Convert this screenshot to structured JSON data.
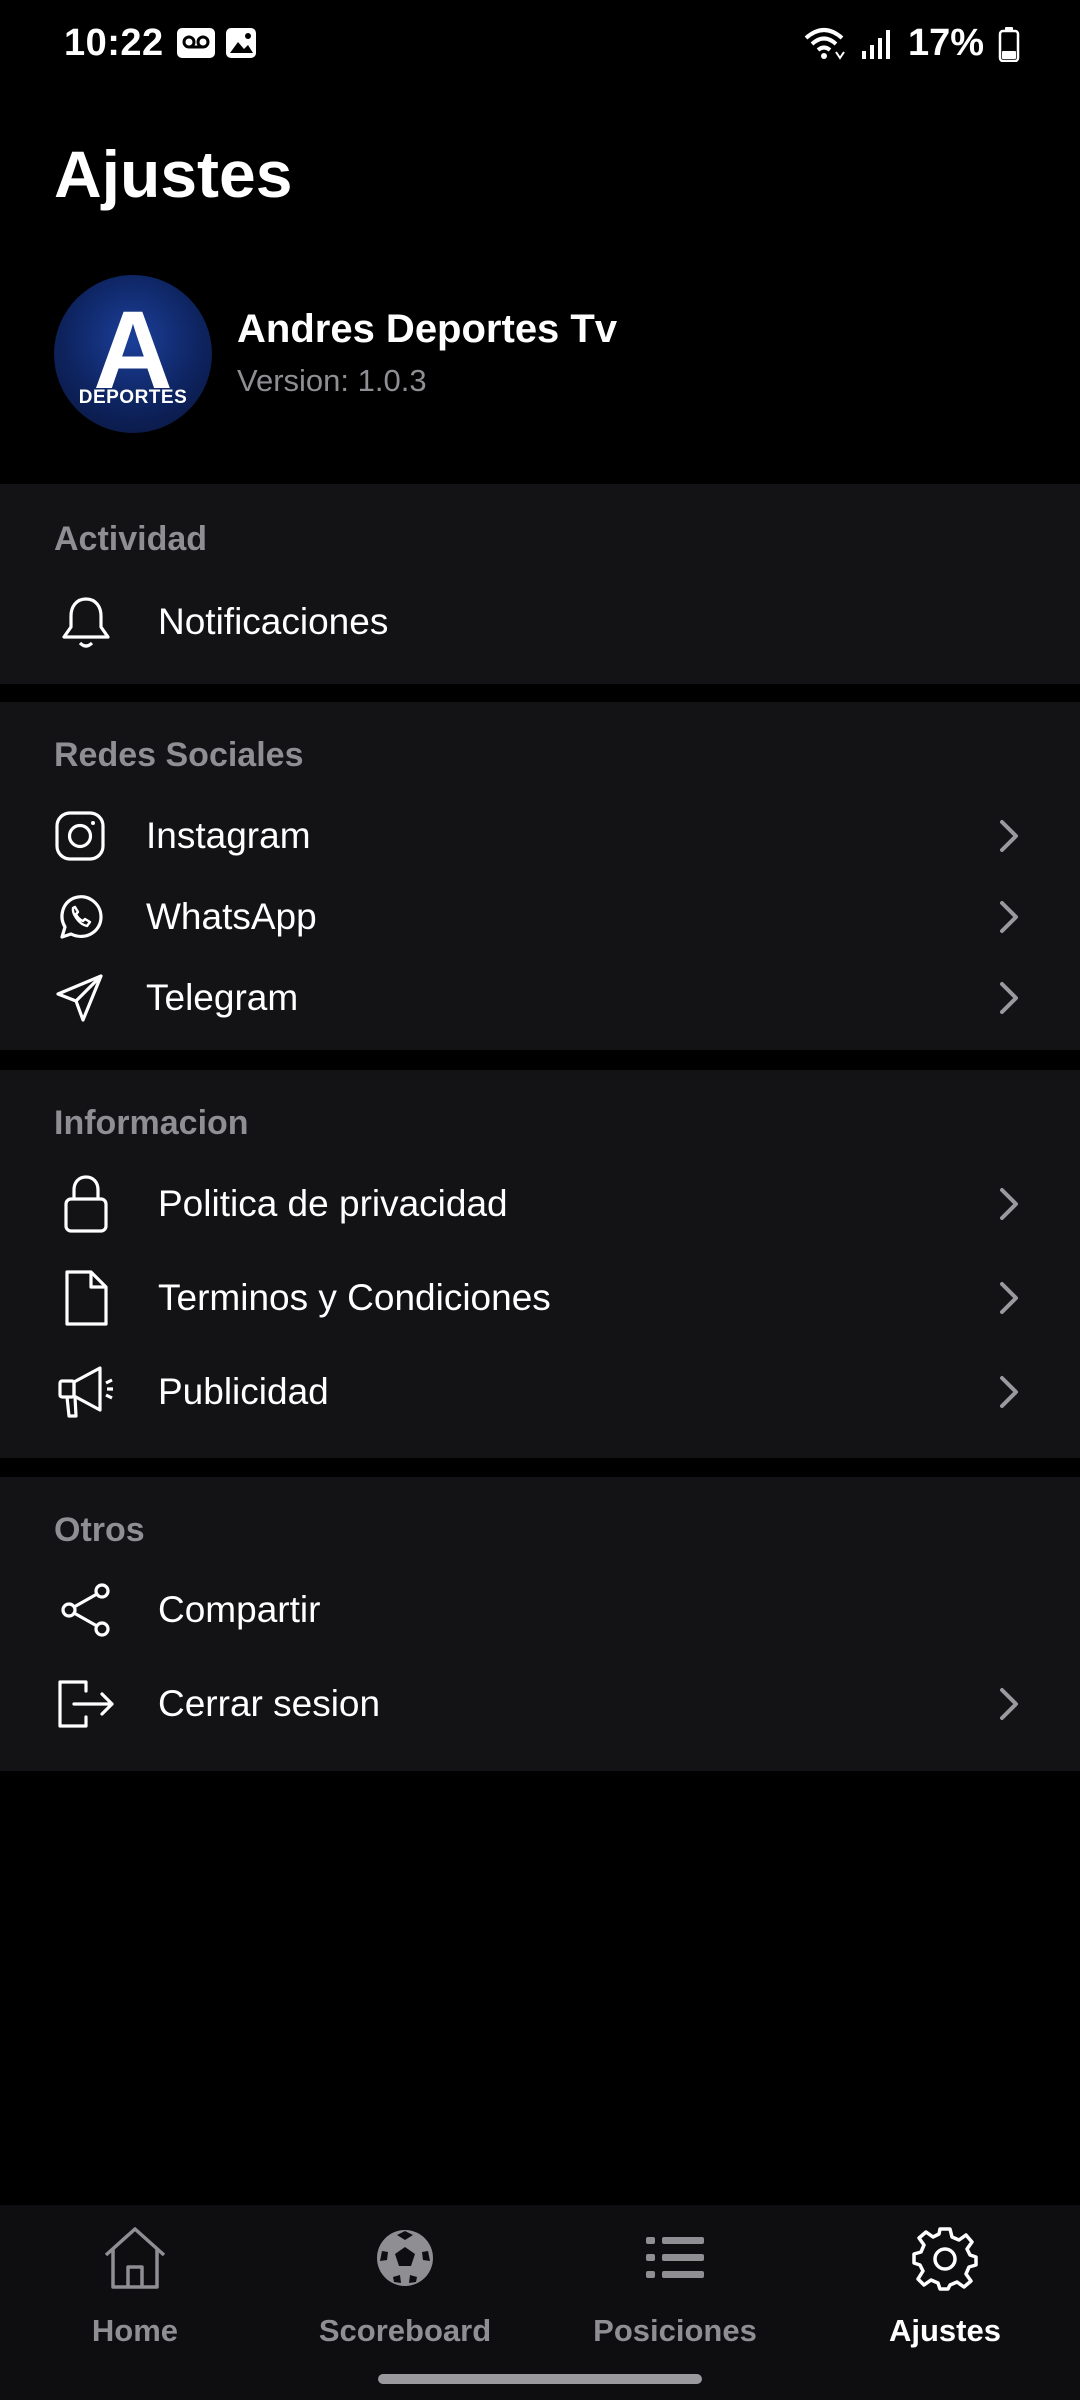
{
  "status_bar": {
    "time": "10:22",
    "battery": "17%"
  },
  "header": {
    "title": "Ajustes"
  },
  "profile": {
    "avatar_letter": "A",
    "avatar_sub": "DEPORTES",
    "name": "Andres Deportes Tv",
    "version": "Version: 1.0.3"
  },
  "sections": {
    "actividad": {
      "title": "Actividad",
      "items": [
        {
          "label": "Notificaciones",
          "icon": "bell-icon"
        }
      ]
    },
    "redes": {
      "title": "Redes Sociales",
      "items": [
        {
          "label": "Instagram",
          "icon": "instagram-icon"
        },
        {
          "label": "WhatsApp",
          "icon": "whatsapp-icon"
        },
        {
          "label": "Telegram",
          "icon": "telegram-icon"
        }
      ]
    },
    "informacion": {
      "title": "Informacion",
      "items": [
        {
          "label": "Politica de privacidad",
          "icon": "lock-icon"
        },
        {
          "label": "Terminos y Condiciones",
          "icon": "document-icon"
        },
        {
          "label": "Publicidad",
          "icon": "megaphone-icon"
        }
      ]
    },
    "otros": {
      "title": "Otros",
      "items": [
        {
          "label": "Compartir",
          "icon": "share-icon"
        },
        {
          "label": "Cerrar sesion",
          "icon": "logout-icon"
        }
      ]
    }
  },
  "bottom_nav": {
    "items": [
      {
        "label": "Home",
        "icon": "home-icon"
      },
      {
        "label": "Scoreboard",
        "icon": "soccer-ball-icon"
      },
      {
        "label": "Posiciones",
        "icon": "list-icon"
      },
      {
        "label": "Ajustes",
        "icon": "gear-icon",
        "active": true
      }
    ]
  },
  "colors": {
    "background": "#000000",
    "section_background": "#131316",
    "muted_text": "#8e8e93",
    "avatar_blue": "#0e2460"
  }
}
